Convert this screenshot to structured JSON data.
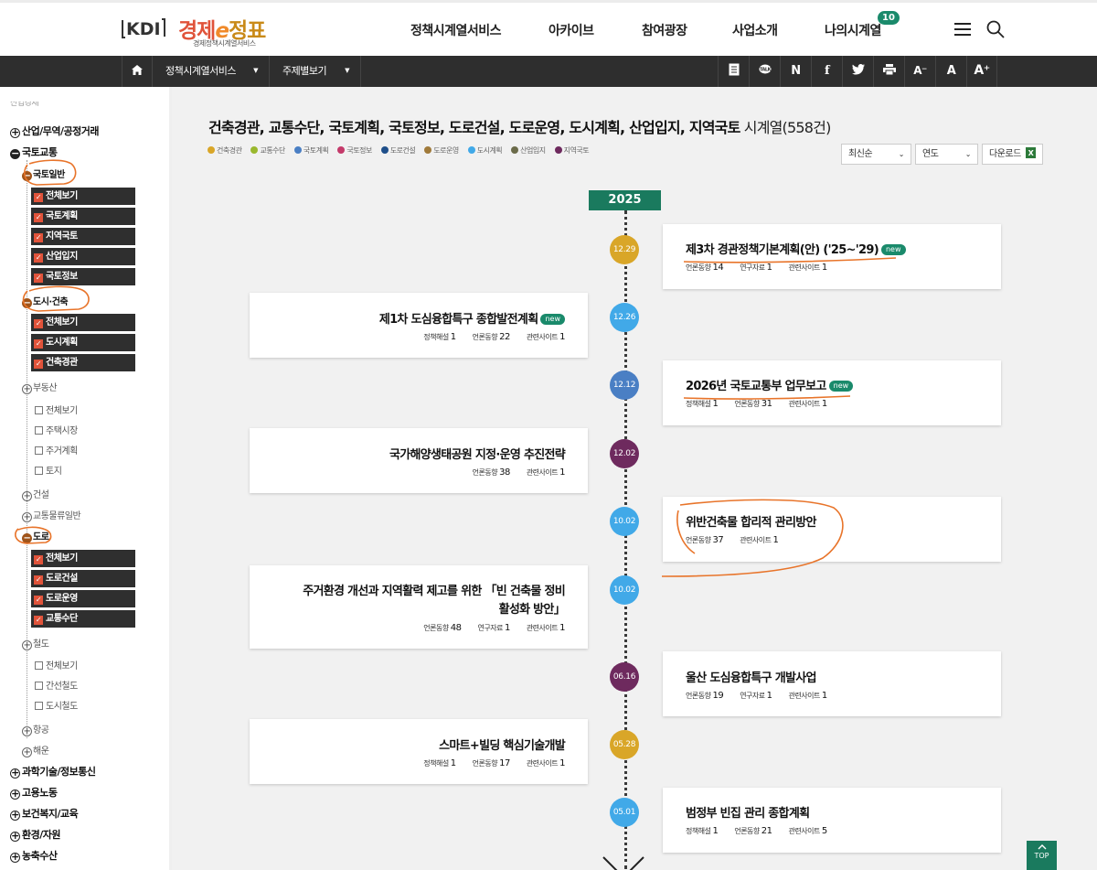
{
  "header": {
    "logo_kdi": "KDI",
    "logo_main_a": "경제",
    "logo_main_e": "e",
    "logo_main_b": "정표",
    "logo_sub": "경제정책시계열서비스",
    "nav": [
      "정책시계열서비스",
      "아카이브",
      "참여광장",
      "사업소개",
      "나의시계열"
    ],
    "my_badge": "10"
  },
  "subbar": {
    "select1": "정책시계열서비스",
    "select2": "주제별보기",
    "icons": [
      "N",
      "f",
      "A⁻",
      "A",
      "A⁺"
    ]
  },
  "sidebar": {
    "top_cut": "산업경제",
    "cats": {
      "trade": "산업/무역/공정거래",
      "land": "국토교통",
      "science": "과학기술/정보통신",
      "labor": "고용노동",
      "welfare": "보건복지/교육",
      "env": "환경/자원",
      "agri": "농축수산"
    },
    "subs": {
      "general": "국토일반",
      "city": "도시·건축",
      "realestate": "부동산",
      "construction": "건설",
      "logistics": "교통물류일반",
      "road": "도로",
      "rail": "철도",
      "airport": "항공",
      "sea": "해운"
    },
    "general_items": [
      "전체보기",
      "국토계획",
      "지역국토",
      "산업입지",
      "국토정보"
    ],
    "city_items": [
      "전체보기",
      "도시계획",
      "건축경관"
    ],
    "realestate_items": [
      "전체보기",
      "주택시장",
      "주거계획",
      "토지"
    ],
    "road_items": [
      "전체보기",
      "도로건설",
      "도로운영",
      "교통수단"
    ],
    "rail_items": [
      "전체보기",
      "간선철도",
      "도시철도"
    ]
  },
  "content": {
    "title": "건축경관, 교통수단, 국토계획, 국토정보, 도로건설, 도로운영, 도시계획, 산업입지, 지역국토",
    "title_suffix": " 시계열(558건)",
    "legend": [
      {
        "label": "건축경관",
        "color": "#d9a628"
      },
      {
        "label": "교통수단",
        "color": "#9ab82e"
      },
      {
        "label": "국토계획",
        "color": "#4a7fc4"
      },
      {
        "label": "국토정보",
        "color": "#c43a6a"
      },
      {
        "label": "도로건설",
        "color": "#1f4f8a"
      },
      {
        "label": "도로운영",
        "color": "#a07a3a"
      },
      {
        "label": "도시계획",
        "color": "#41a9e8"
      },
      {
        "label": "산업입지",
        "color": "#6b6b4a"
      },
      {
        "label": "지역국토",
        "color": "#6e2a5e"
      }
    ],
    "sort_select": "최신순",
    "year_select": "연도",
    "download": "다운로드",
    "year": "2025",
    "new_label": "new",
    "top_label": "TOP",
    "items": [
      {
        "date": "12.29",
        "color": "#d9a628",
        "title": "제3차 경관정책기본계획(안) ('25~'29)",
        "new": true,
        "meta": [
          [
            "언론동향",
            "14"
          ],
          [
            "연구자료",
            "1"
          ],
          [
            "관련사이트",
            "1"
          ]
        ]
      },
      {
        "date": "12.26",
        "color": "#41a9e8",
        "title": "제1차 도심융합특구 종합발전계획",
        "new": true,
        "meta": [
          [
            "정책해설",
            "1"
          ],
          [
            "언론동향",
            "22"
          ],
          [
            "관련사이트",
            "1"
          ]
        ]
      },
      {
        "date": "12.12",
        "color": "#4a7fc4",
        "title": "2026년 국토교통부 업무보고",
        "new": true,
        "meta": [
          [
            "정책해설",
            "1"
          ],
          [
            "언론동향",
            "31"
          ],
          [
            "관련사이트",
            "1"
          ]
        ]
      },
      {
        "date": "12.02",
        "color": "#6e2a5e",
        "title": "국가해양생태공원 지정·운영 추진전략",
        "new": false,
        "meta": [
          [
            "언론동향",
            "38"
          ],
          [
            "관련사이트",
            "1"
          ]
        ]
      },
      {
        "date": "10.02",
        "color": "#41a9e8",
        "title": "위반건축물 합리적 관리방안",
        "new": false,
        "meta": [
          [
            "언론동향",
            "37"
          ],
          [
            "관련사이트",
            "1"
          ]
        ]
      },
      {
        "date": "10.02",
        "color": "#41a9e8",
        "title": "주거환경 개선과 지역활력 제고를 위한 「빈 건축물 정비",
        "title2": "활성화 방안」",
        "new": false,
        "meta": [
          [
            "언론동향",
            "48"
          ],
          [
            "연구자료",
            "1"
          ],
          [
            "관련사이트",
            "1"
          ]
        ]
      },
      {
        "date": "06.16",
        "color": "#6e2a5e",
        "title": "울산 도심융합특구 개발사업",
        "new": false,
        "meta": [
          [
            "언론동향",
            "19"
          ],
          [
            "연구자료",
            "1"
          ],
          [
            "관련사이트",
            "1"
          ]
        ]
      },
      {
        "date": "05.28",
        "color": "#d9a628",
        "title": "스마트+빌딩 핵심기술개발",
        "new": false,
        "meta": [
          [
            "정책해설",
            "1"
          ],
          [
            "언론동향",
            "17"
          ],
          [
            "관련사이트",
            "1"
          ]
        ]
      },
      {
        "date": "05.01",
        "color": "#41a9e8",
        "title": "범정부 빈집 관리 종합계획",
        "new": false,
        "meta": [
          [
            "정책해설",
            "1"
          ],
          [
            "언론동향",
            "21"
          ],
          [
            "관련사이트",
            "5"
          ]
        ]
      }
    ]
  }
}
